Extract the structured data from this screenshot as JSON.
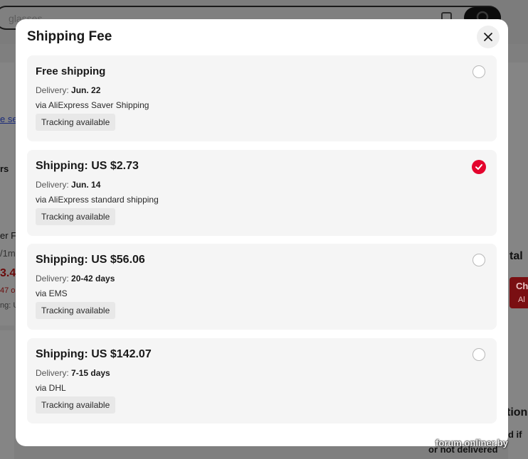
{
  "background": {
    "search_placeholder": "glasses",
    "fragments": [
      "e se",
      "rs",
      "er F",
      "/1m",
      "3.4",
      "47 o",
      "ng: U",
      "tal",
      "Ch",
      "Al",
      "tion",
      "nd if",
      "or not delivered"
    ]
  },
  "modal": {
    "title": "Shipping Fee",
    "close_icon": "close-icon",
    "delivery_label": "Delivery:",
    "options": [
      {
        "title": "Free shipping",
        "delivery_value": "Jun. 22",
        "via": "via AliExpress Saver Shipping",
        "tag": "Tracking available",
        "selected": false
      },
      {
        "title": "Shipping: US $2.73",
        "delivery_value": "Jun. 14",
        "via": "via AliExpress standard shipping",
        "tag": "Tracking available",
        "selected": true
      },
      {
        "title": "Shipping: US $56.06",
        "delivery_value": "20-42 days",
        "via": "via EMS",
        "tag": "Tracking available",
        "selected": false
      },
      {
        "title": "Shipping: US $142.07",
        "delivery_value": "7-15 days",
        "via": "via DHL",
        "tag": "Tracking available",
        "selected": false
      }
    ]
  },
  "watermark": "forum.onliner.by",
  "colors": {
    "accent": "#e4032d",
    "overlay": "#7f7f7f",
    "card": "#f5f5f5"
  }
}
